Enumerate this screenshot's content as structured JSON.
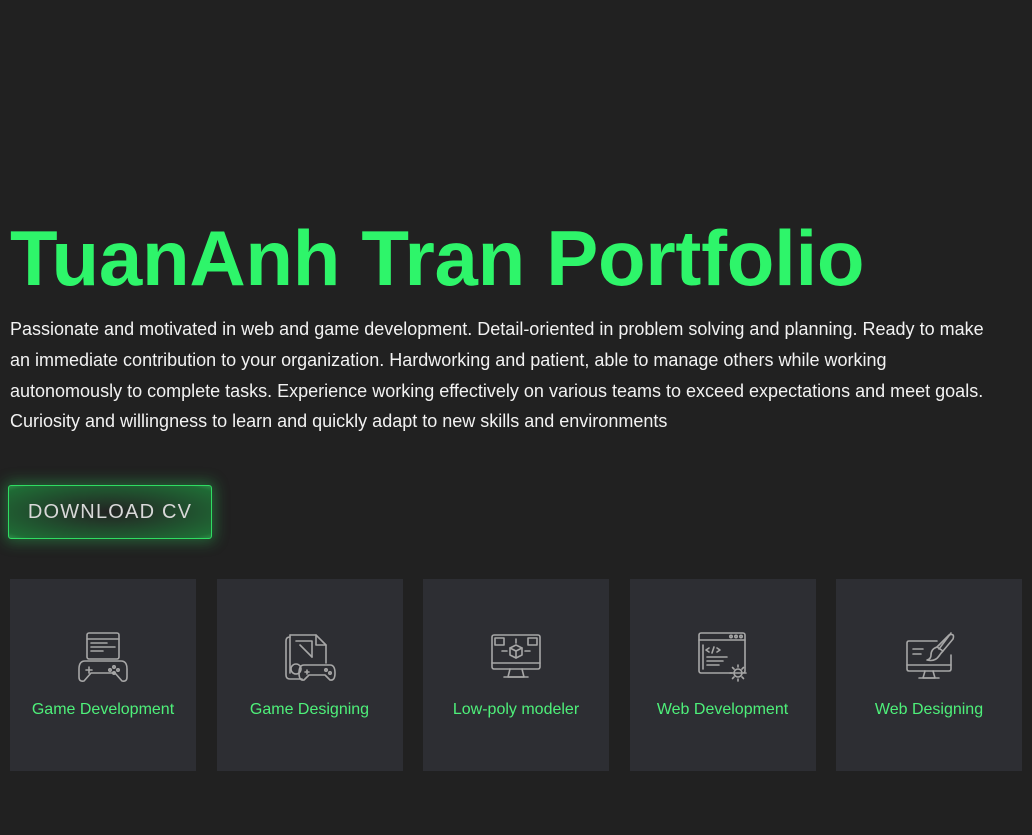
{
  "theme": {
    "accent": "#2ef56a",
    "label_color": "#4ef07a",
    "icon_color": "#a7a7a7",
    "background": "#212121",
    "card_background": "#2d2e33"
  },
  "hero": {
    "title": "TuanAnh Tran Portfolio",
    "description": "Passionate and motivated in web and game development. Detail-oriented in problem solving and planning. Ready to make an immediate contribution to your organization. Hardworking and patient, able to manage others while working autonomously to complete tasks. Experience working effectively on various teams to exceed expectations and meet goals. Curiosity and willingness to learn and quickly adapt to new skills and environments",
    "cv_button_label": "DOWNLOAD CV"
  },
  "skills": [
    {
      "label": "Game Development",
      "icon": "gamepad-code-icon"
    },
    {
      "label": "Game Designing",
      "icon": "game-design-icon"
    },
    {
      "label": "Low-poly modeler",
      "icon": "3d-modeling-monitor-icon"
    },
    {
      "label": "Web Development",
      "icon": "web-code-gear-icon"
    },
    {
      "label": "Web Designing",
      "icon": "web-design-brush-icon"
    }
  ]
}
